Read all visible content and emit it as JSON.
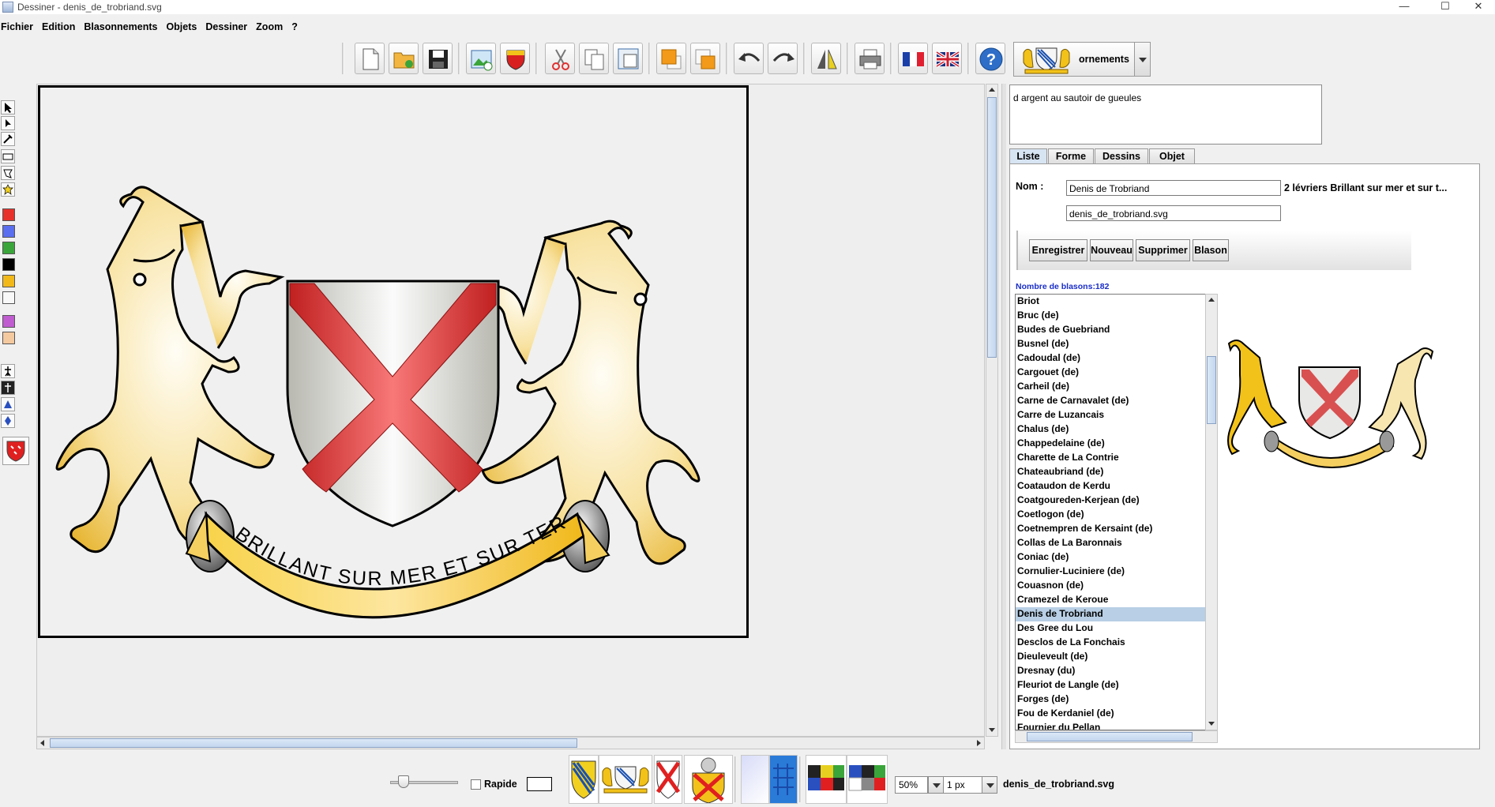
{
  "window": {
    "title": "Dessiner - denis_de_trobriand.svg",
    "minimize": "—",
    "maximize": "☐",
    "close": "✕"
  },
  "menu": [
    "Fichier",
    "Edition",
    "Blasonnements",
    "Objets",
    "Dessiner",
    "Zoom",
    "?"
  ],
  "toolbar": {
    "icons": [
      "new-file-icon",
      "open-folder-icon",
      "save-icon",
      "insert-image-icon",
      "shield-icon",
      "cut-icon",
      "copy-icon",
      "paste-icon",
      "bring-front-icon",
      "send-back-icon",
      "undo-icon",
      "redo-icon",
      "mirror-icon",
      "print-icon",
      "french-flag-icon",
      "uk-flag-icon",
      "help-icon"
    ],
    "ornaments_label": "ornements"
  },
  "blazon_description": "d argent au sautoir de gueules",
  "motto": "BRILLANT SUR MER ET SUR TERRE",
  "tabs": [
    "Liste",
    "Forme",
    "Dessins",
    "Objet"
  ],
  "active_tab": "Liste",
  "form": {
    "nom_label": "Nom :",
    "nom_value": "Denis de Trobriand",
    "nom_note": "2 lévriers Brillant sur mer et sur t...",
    "file_value": "denis_de_trobriand.svg"
  },
  "actions": [
    "Enregistrer",
    "Nouveau",
    "Supprimer",
    "Blason"
  ],
  "count_label": "Nombre de blasons:182",
  "list_items": [
    "Briot",
    "Bruc (de)",
    "Budes de Guebriand",
    "Busnel (de)",
    "Cadoudal (de)",
    "Cargouet (de)",
    "Carheil (de)",
    "Carne de Carnavalet (de)",
    "Carre de Luzancais",
    "Chalus (de)",
    "Chappedelaine (de)",
    "Charette de La Contrie",
    "Chateaubriand (de)",
    "Coataudon de Kerdu",
    "Coatgoureden-Kerjean (de)",
    "Coetlogon (de)",
    "Coetnempren de Kersaint (de)",
    "Collas de La Baronnais",
    "Coniac (de)",
    "Cornulier-Luciniere (de)",
    "Couasnon (de)",
    "Cramezel de Keroue",
    "Denis de Trobriand",
    "Des Gree du Lou",
    "Desclos de La Fonchais",
    "Dieuleveult (de)",
    "Dresnay (du)",
    "Fleuriot de Langle (de)",
    "Forges (de)",
    "Fou de Kerdaniel (de)",
    "Fournier du Pellan"
  ],
  "selected_item": "Denis de Trobriand",
  "palette_colors": [
    "#e8302a",
    "#5a6ef0",
    "#3aa53a",
    "#000000",
    "#f2b81a",
    "#f8f8f8",
    "#c05cd0",
    "#f5c9a0"
  ],
  "statusbar": {
    "rapide_label": "Rapide",
    "zoom_value": "50%",
    "stroke_value": "1 px",
    "filename": "denis_de_trobriand.svg"
  }
}
